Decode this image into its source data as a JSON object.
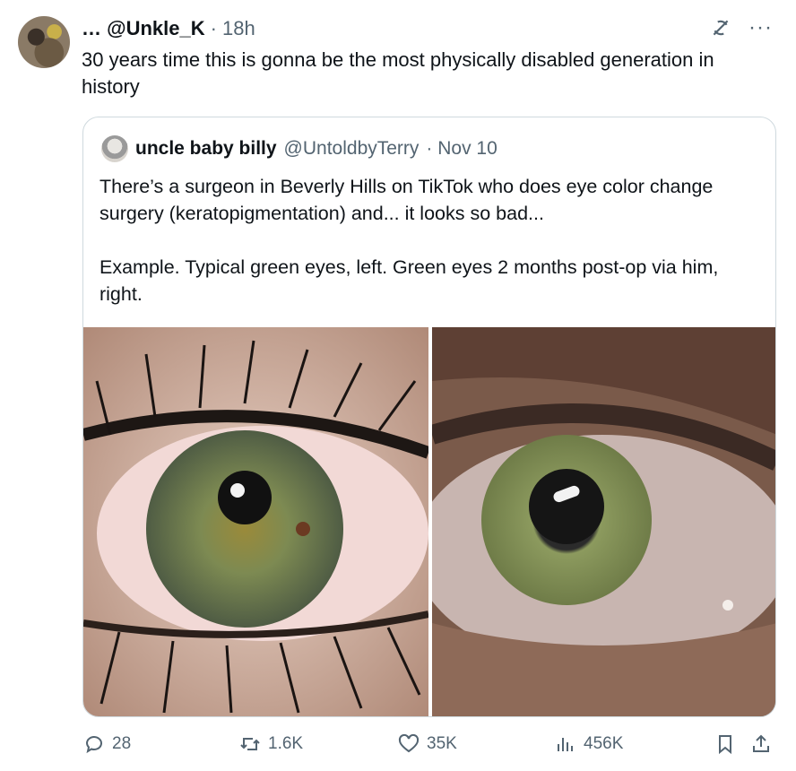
{
  "tweet": {
    "handle": "… @Unkle_K",
    "time": "· 18h",
    "text": "30 years time this is gonna be the most physically disabled generation in history"
  },
  "quote": {
    "name": "uncle baby billy",
    "handle": "@UntoldbyTerry",
    "date": "· Nov 10",
    "text": "There’s a surgeon in Beverly Hills on TikTok who does eye color change surgery (keratopigmentation) and... it looks so bad...\n\nExample. Typical green eyes, left. Green eyes 2 months post-op via him, right."
  },
  "actions": {
    "replies": "28",
    "reposts": "1.6K",
    "likes": "35K",
    "views": "456K"
  },
  "icons": [
    "grok-icon",
    "more-icon",
    "reply-icon",
    "repost-icon",
    "like-icon",
    "views-icon",
    "bookmark-icon",
    "share-icon"
  ],
  "colors": {
    "text": "#0f1419",
    "muted": "#536471",
    "border": "#cfd9de"
  }
}
